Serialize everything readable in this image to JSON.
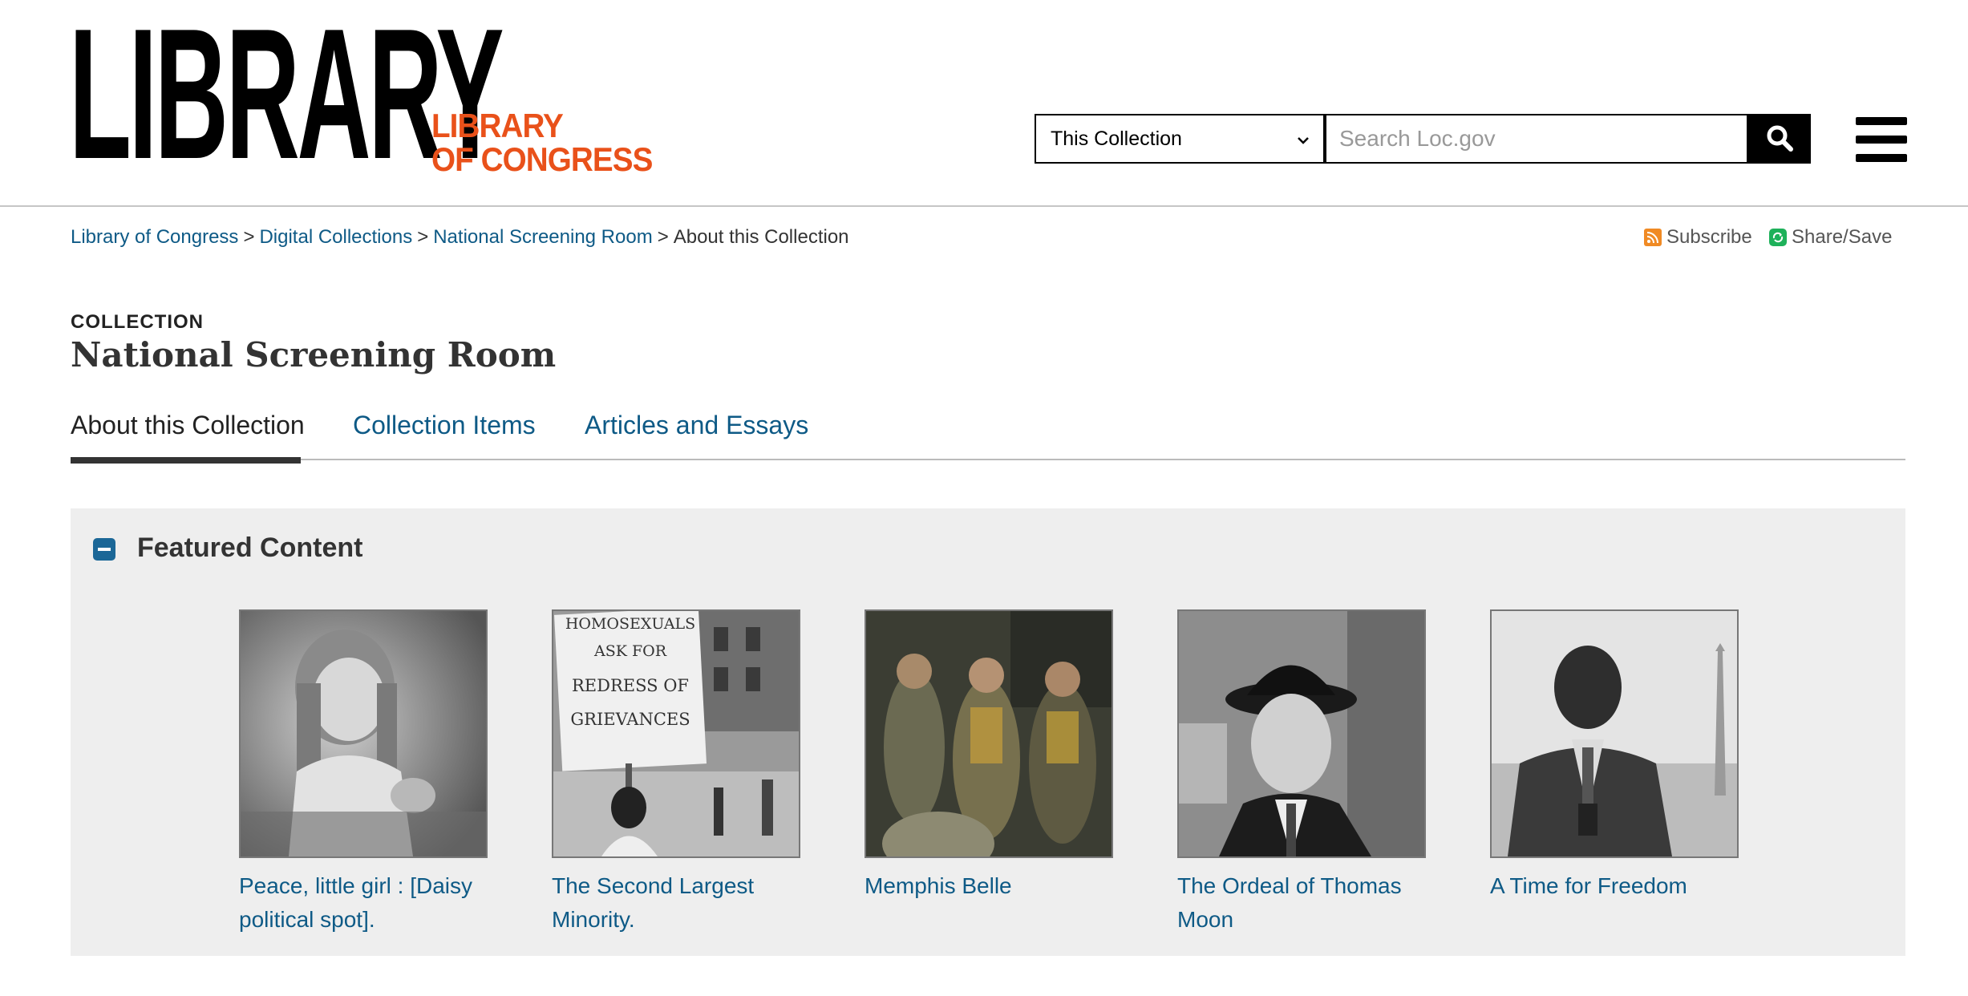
{
  "header": {
    "logo_main": "LIBRARY",
    "logo_sub_line1": "LIBRARY",
    "logo_sub_line2": "OF CONGRESS",
    "search_scope": "This Collection",
    "search_placeholder": "Search Loc.gov",
    "search_icon": "search-icon",
    "menu_icon": "hamburger-menu-icon"
  },
  "breadcrumb": {
    "items": [
      "Library of Congress",
      "Digital Collections",
      "National Screening Room"
    ],
    "current": "About this Collection",
    "separator": ">"
  },
  "utility": {
    "subscribe": "Subscribe",
    "share": "Share/Save",
    "subscribe_icon": "rss-icon",
    "share_icon": "share-icon"
  },
  "collection": {
    "kicker": "COLLECTION",
    "title": "National Screening Room"
  },
  "tabs": [
    "About this Collection",
    "Collection Items",
    "Articles and Essays"
  ],
  "featured": {
    "heading": "Featured Content",
    "toggle_icon": "collapse-minus-icon",
    "items": [
      {
        "title": "Peace, little girl : [Daisy political spot]."
      },
      {
        "title": "The Second Largest Minority."
      },
      {
        "title": "Memphis Belle"
      },
      {
        "title": "The Ordeal of Thomas Moon"
      },
      {
        "title": "A Time for Freedom"
      }
    ],
    "sign_text": [
      "HOMOSEXUALS",
      "ASK FOR",
      "REDRESS OF",
      "GRIEVANCES"
    ]
  },
  "colors": {
    "link": "#0e5a86",
    "brand_orange": "#e9511a",
    "panel_bg": "#eeeeee",
    "toggle": "#1b6797"
  }
}
